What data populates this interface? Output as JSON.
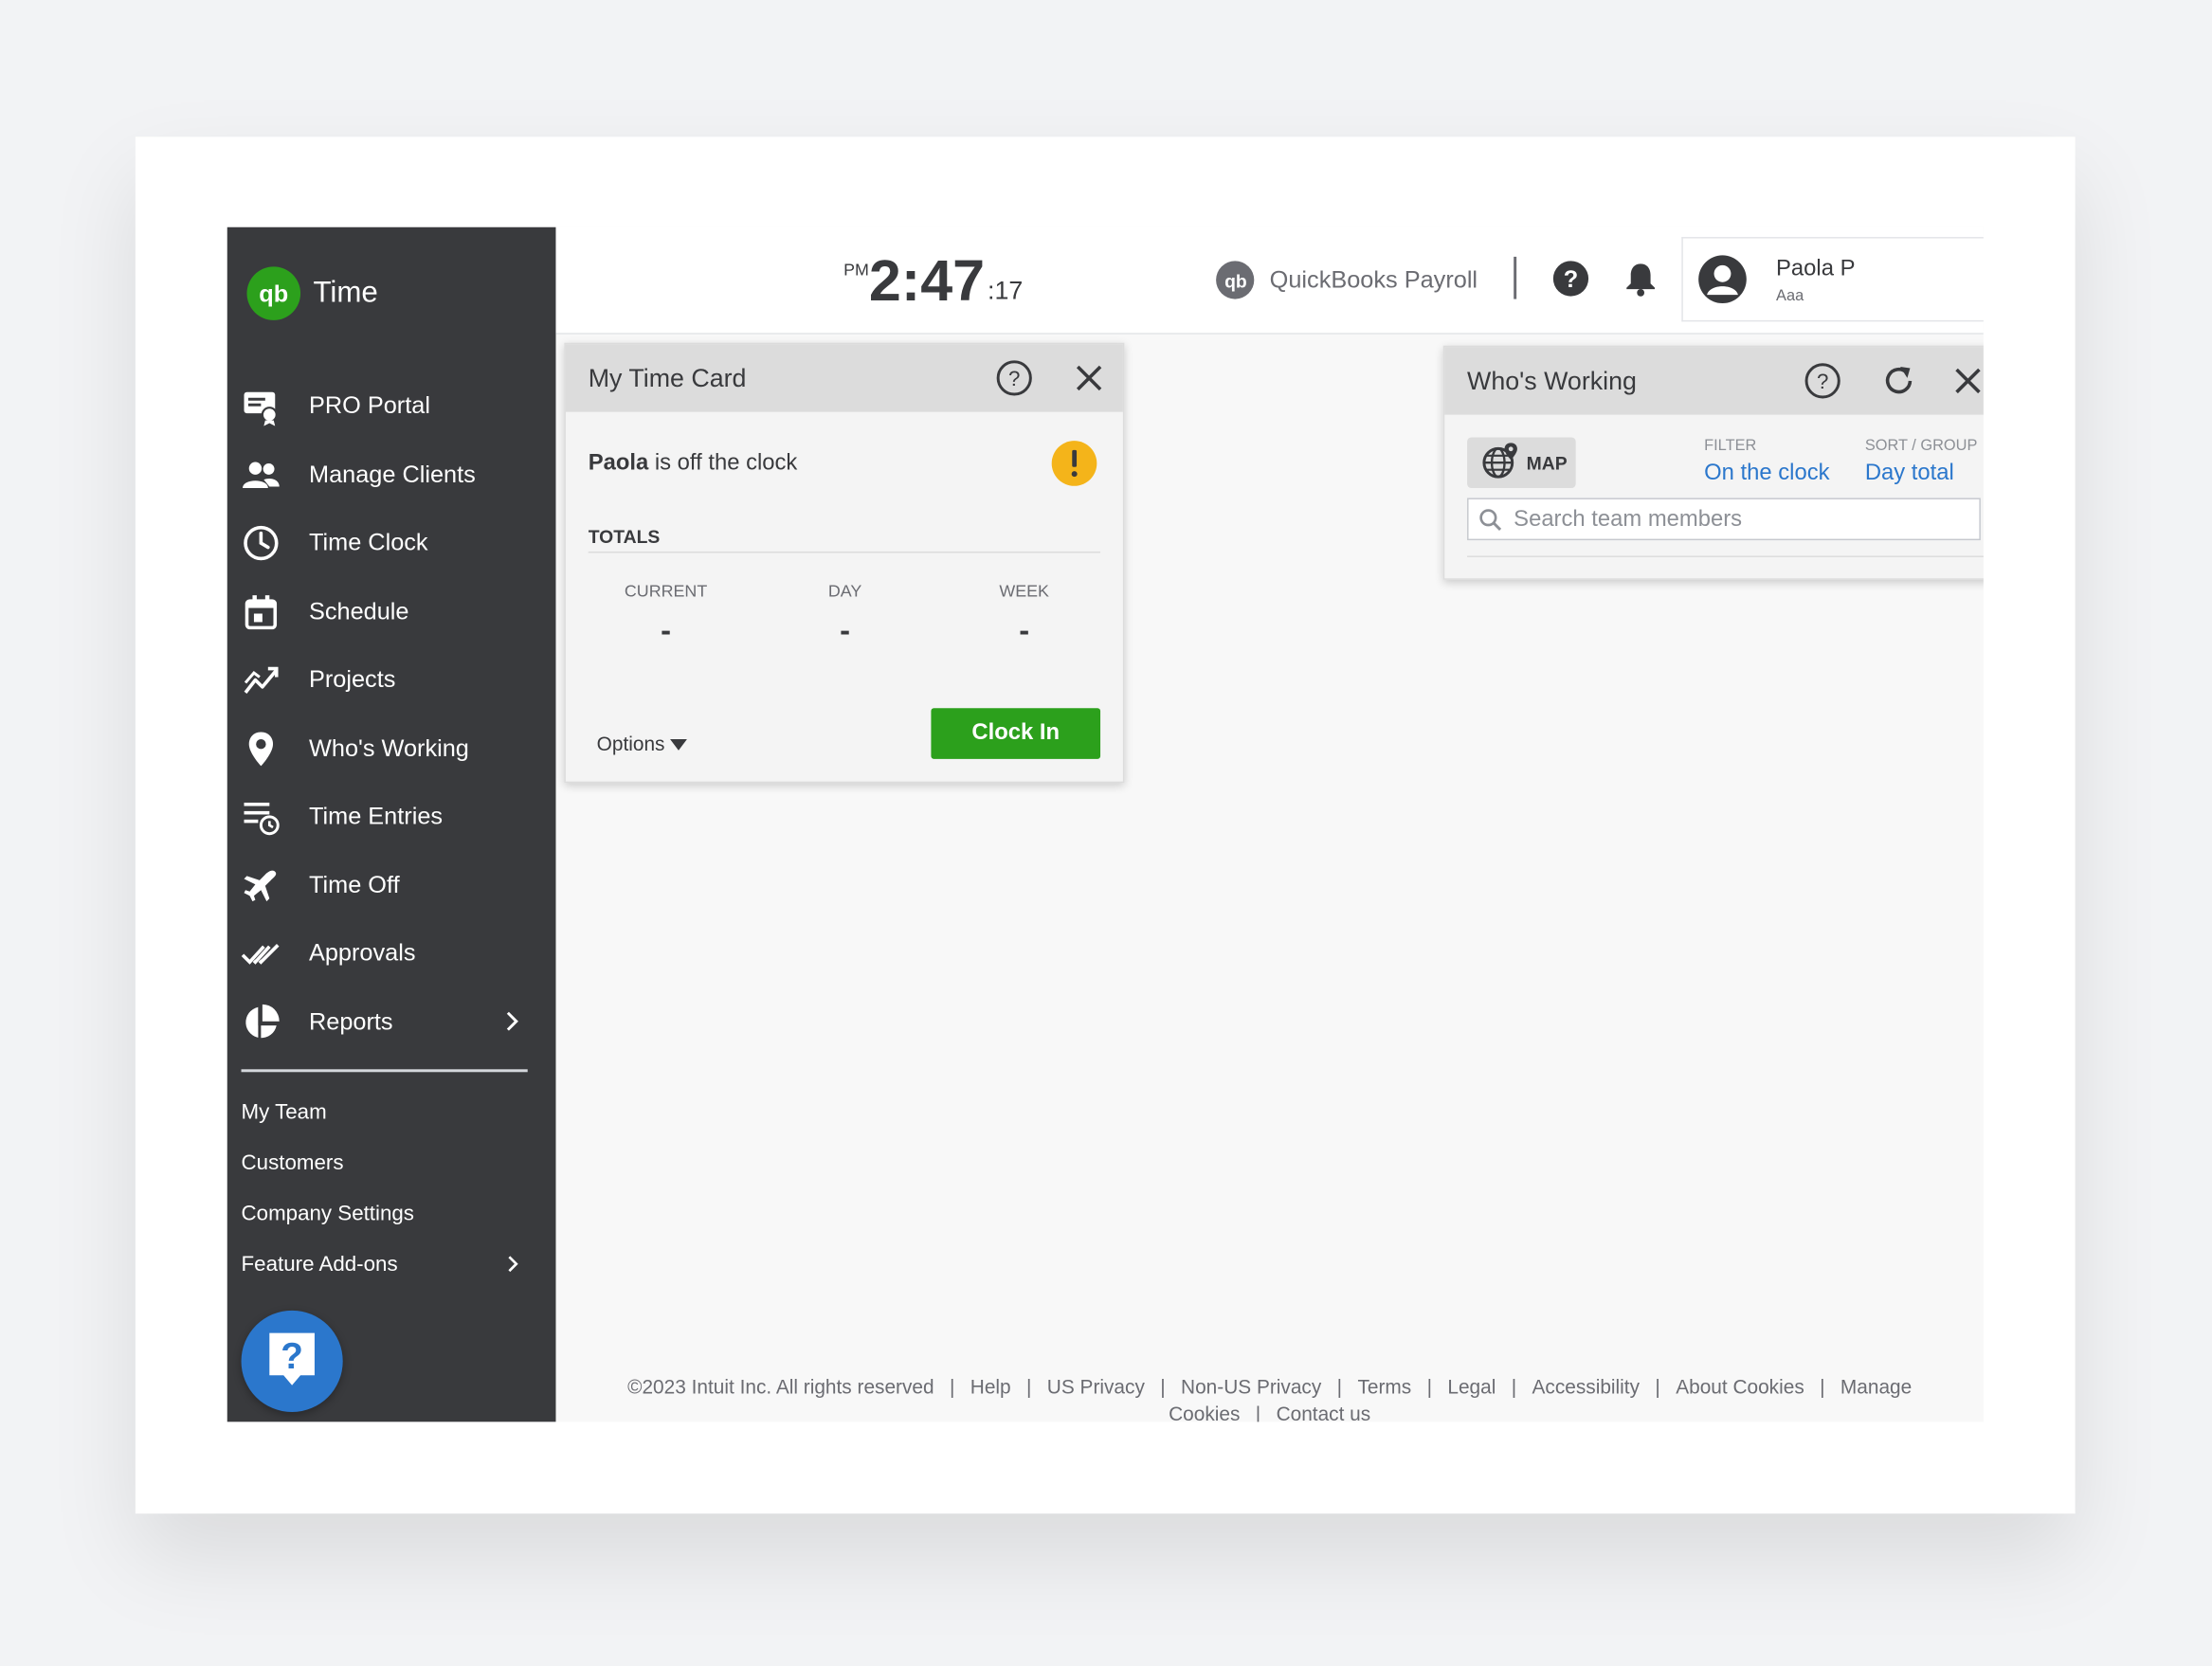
{
  "brand": {
    "name": "Time",
    "logo_color": "#2ca01c"
  },
  "sidebar": {
    "items": [
      {
        "label": "PRO Portal",
        "icon": "pro-portal-icon"
      },
      {
        "label": "Manage Clients",
        "icon": "people-icon"
      },
      {
        "label": "Time Clock",
        "icon": "clock-icon"
      },
      {
        "label": "Schedule",
        "icon": "calendar-icon"
      },
      {
        "label": "Projects",
        "icon": "trend-icon"
      },
      {
        "label": "Who's Working",
        "icon": "location-pin-icon"
      },
      {
        "label": "Time Entries",
        "icon": "time-entries-icon"
      },
      {
        "label": "Time Off",
        "icon": "airplane-icon"
      },
      {
        "label": "Approvals",
        "icon": "double-check-icon"
      },
      {
        "label": "Reports",
        "icon": "pie-chart-icon"
      }
    ],
    "sub_items": [
      {
        "label": "My Team"
      },
      {
        "label": "Customers"
      },
      {
        "label": "Company Settings"
      },
      {
        "label": "Feature Add-ons"
      }
    ],
    "help_icon": "help-chat-icon"
  },
  "topbar": {
    "clock": {
      "ampm": "PM",
      "hm": "2:47",
      "seconds": ":17"
    },
    "payroll_label": "QuickBooks Payroll",
    "user": {
      "name": "Paola P",
      "company": "Aaa"
    }
  },
  "timecard": {
    "title": "My Time Card",
    "employee": "Paola",
    "status_text": " is off the clock",
    "totals_label": "TOTALS",
    "columns": [
      {
        "header": "CURRENT",
        "value": "-"
      },
      {
        "header": "DAY",
        "value": "-"
      },
      {
        "header": "WEEK",
        "value": "-"
      }
    ],
    "options_label": "Options",
    "clock_in_label": "Clock In"
  },
  "whos_working": {
    "title": "Who's Working",
    "map_label": "MAP",
    "filter_label": "FILTER",
    "filter_value": "On the clock",
    "sort_label": "SORT / GROUP",
    "sort_value": "Day total",
    "search_placeholder": "Search team members"
  },
  "footer": {
    "copyright": "©2023 Intuit Inc. All rights reserved",
    "links": [
      "Help",
      "US Privacy",
      "Non-US Privacy",
      "Terms",
      "Legal",
      "Accessibility",
      "About Cookies",
      "Manage Cookies",
      "Contact us"
    ]
  },
  "colors": {
    "sidebar_bg": "#393a3d",
    "accent_green": "#2ca01c",
    "link_blue": "#2b77cc",
    "alert_yellow": "#f4b41a"
  }
}
